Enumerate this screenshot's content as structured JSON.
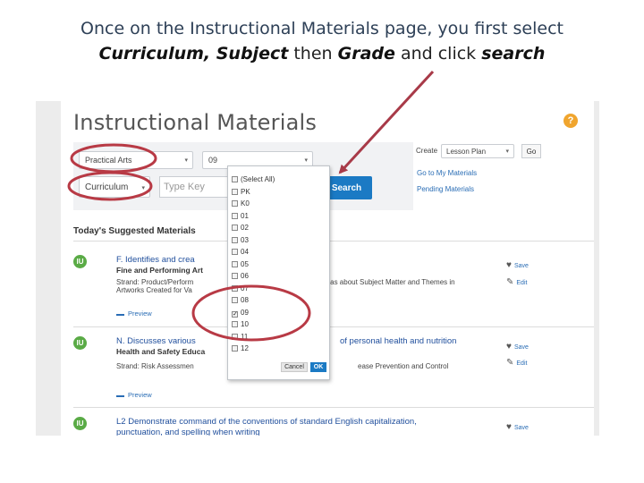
{
  "caption": {
    "line1": "Once on the Instructional Materials page, you first select",
    "line2_curriculum_subject": "Curriculum, Subject",
    "line2_then": " then ",
    "line2_grade": "Grade",
    "line2_and_click": " and click ",
    "line2_search": "search"
  },
  "app": {
    "title": "Instructional Materials",
    "help_icon": "?",
    "filters": {
      "subject_value": "Practical Arts",
      "grade_value": "09",
      "curriculum_value": "Curriculum",
      "keyword_placeholder": "Type Key",
      "search_label": "Search"
    },
    "create": {
      "label": "Create",
      "type_value": "Lesson Plan",
      "go_label": "Go",
      "link_my_materials": "Go to My Materials",
      "link_pending": "Pending Materials"
    },
    "suggested_title": "Today's Suggested Materials",
    "grade_dropdown": {
      "options": [
        {
          "label": "(Select All)",
          "checked": false
        },
        {
          "label": "PK",
          "checked": false
        },
        {
          "label": "K0",
          "checked": false
        },
        {
          "label": "01",
          "checked": false
        },
        {
          "label": "02",
          "checked": false
        },
        {
          "label": "03",
          "checked": false
        },
        {
          "label": "04",
          "checked": false
        },
        {
          "label": "05",
          "checked": false
        },
        {
          "label": "06",
          "checked": false
        },
        {
          "label": "07",
          "checked": false
        },
        {
          "label": "08",
          "checked": false
        },
        {
          "label": "09",
          "checked": true
        },
        {
          "label": "10",
          "checked": false
        },
        {
          "label": "11",
          "checked": false
        },
        {
          "label": "12",
          "checked": false
        }
      ],
      "cancel_label": "Cancel",
      "ok_label": "OK"
    },
    "materials": [
      {
        "badge": "IU",
        "title_left": "F. Identifies and crea",
        "subject_left": "Fine and Performing Art",
        "strand_left": "Strand: Product/Perform",
        "strand_right": "Ideas about Subject Matter and Themes in",
        "strand_line2": "Artworks Created for Va",
        "preview": "Preview",
        "save": "Save",
        "edit": "Edit"
      },
      {
        "badge": "IU",
        "title_left": "N. Discusses various",
        "title_right": "of personal health and nutrition",
        "subject_left": "Health and Safety Educa",
        "strand_left": "Strand: Risk Assessmen",
        "strand_right": "ease Prevention and Control",
        "preview": "Preview",
        "save": "Save",
        "edit": "Edit"
      },
      {
        "badge": "IU",
        "title_left": "L2 Demonstrate command of the conventions of standard English capitalization,",
        "title_line2": "punctuation, and spelling when writing",
        "save": "Save"
      }
    ]
  },
  "colors": {
    "accent_blue": "#1b7ac4",
    "highlight_ring": "#b83a45",
    "arrow": "#a83a48",
    "badge_green": "#5aab46",
    "help_orange": "#f0a52e"
  }
}
